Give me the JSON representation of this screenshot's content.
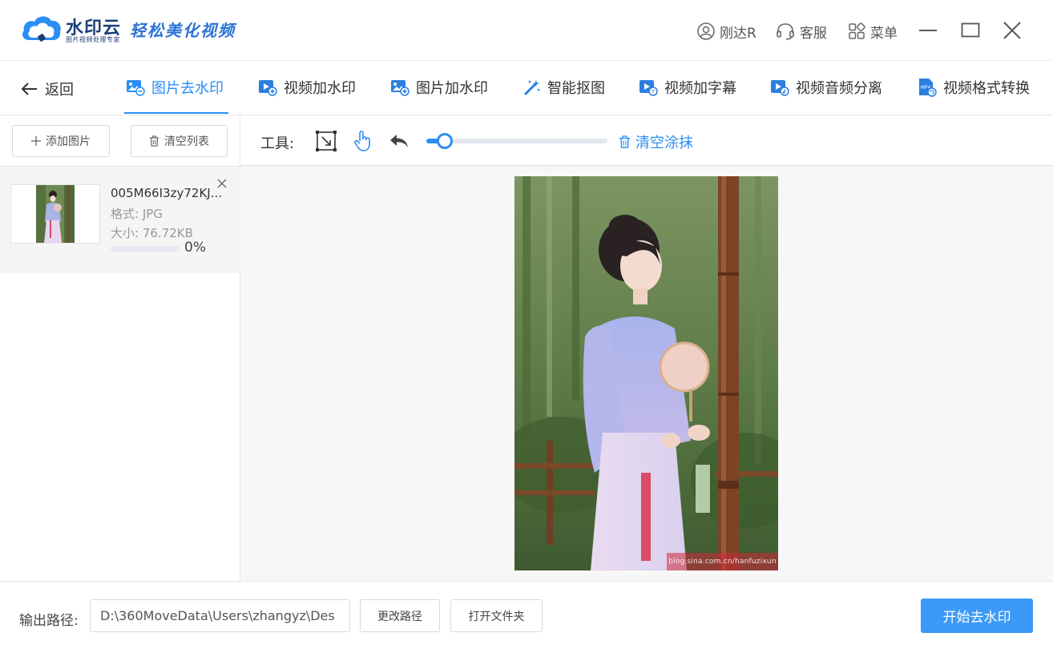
{
  "app": {
    "brand_name": "水印云",
    "brand_sub": "图片视频处理专家",
    "slogan": "轻松美化视频",
    "accent_color": "#2a8ef5"
  },
  "titlebar": {
    "user_label": "刚达R",
    "service_label": "客服",
    "menu_label": "菜单",
    "icons": [
      "user-icon",
      "headset-icon",
      "grid-menu-icon",
      "minimize-icon",
      "maximize-icon",
      "close-icon"
    ]
  },
  "nav": {
    "back_label": "返回",
    "tabs": [
      {
        "label": "图片去水印",
        "icon": "image-remove-icon",
        "active": true
      },
      {
        "label": "视频加水印",
        "icon": "video-add-watermark-icon",
        "active": false
      },
      {
        "label": "图片加水印",
        "icon": "image-add-watermark-icon",
        "active": false
      },
      {
        "label": "智能抠图",
        "icon": "magic-wand-icon",
        "active": false
      },
      {
        "label": "视频加字幕",
        "icon": "video-subtitle-icon",
        "active": false
      },
      {
        "label": "视频音频分离",
        "icon": "video-audio-split-icon",
        "active": false
      },
      {
        "label": "视频格式转换",
        "icon": "mp4-format-icon",
        "active": false
      }
    ]
  },
  "sidebar": {
    "add_button": "添加图片",
    "clear_button": "清空列表",
    "files": [
      {
        "name": "005M66I3zy72KJ...",
        "format_label": "格式:",
        "format_value": "JPG",
        "size_label": "大小:",
        "size_value": "76.72KB",
        "progress": 0,
        "progress_text": "0%"
      }
    ]
  },
  "toolbar": {
    "label": "工具:",
    "tools": [
      "select-box-icon",
      "hand-pointer-icon",
      "undo-icon"
    ],
    "brush_size_fraction": 0.1,
    "clear_label": "清空涂抹"
  },
  "canvas": {
    "watermark_text": "blog.sina.com.cn/hanfuzixun"
  },
  "footer": {
    "output_label": "输出路径:",
    "output_path": "D:\\360MoveData\\Users\\zhangyz\\Des",
    "change_path_button": "更改路径",
    "open_folder_button": "打开文件夹",
    "start_button": "开始去水印"
  }
}
